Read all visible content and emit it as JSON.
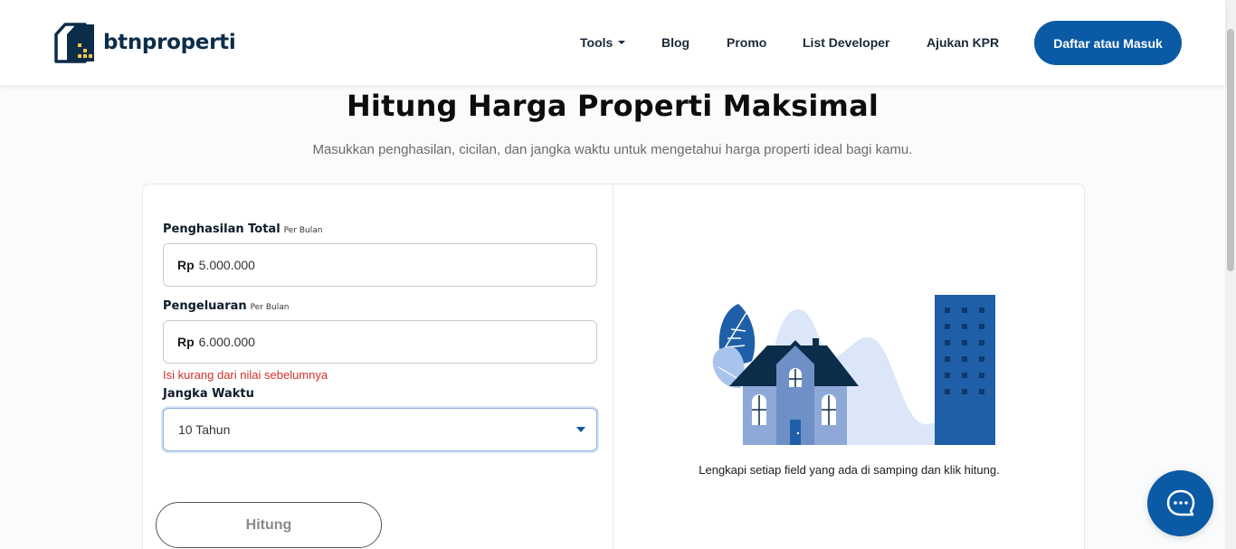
{
  "header": {
    "logo_text": "btnproperti",
    "nav": {
      "tools": "Tools",
      "blog": "Blog",
      "promo": "Promo",
      "list_developer": "List Developer",
      "ajukan_kpr": "Ajukan KPR"
    },
    "login_button": "Daftar atau Masuk"
  },
  "main": {
    "title": "Hitung Harga Properti Maksimal",
    "subtitle": "Masukkan penghasilan, cicilan, dan jangka waktu untuk mengetahui harga properti ideal bagi kamu."
  },
  "form": {
    "income": {
      "label": "Penghasilan Total",
      "sublabel": "Per Bulan",
      "prefix": "Rp",
      "value": "5.000.000"
    },
    "expense": {
      "label": "Pengeluaran",
      "sublabel": "Per Bulan",
      "prefix": "Rp",
      "value": "6.000.000",
      "error": "Isi kurang dari nilai sebelumnya"
    },
    "term": {
      "label": "Jangka Waktu",
      "selected": "10 Tahun"
    },
    "submit_label": "Hitung"
  },
  "result": {
    "hint": "Lengkapi setiap field yang ada di samping dan klik hitung."
  },
  "colors": {
    "brand_blue": "#0a5aa5",
    "navy": "#0c2d4a",
    "error_red": "#d0312d"
  },
  "icons": {
    "logo": "house-logo-icon",
    "chat": "chat-bubble-icon",
    "dropdown": "caret-down-icon"
  }
}
